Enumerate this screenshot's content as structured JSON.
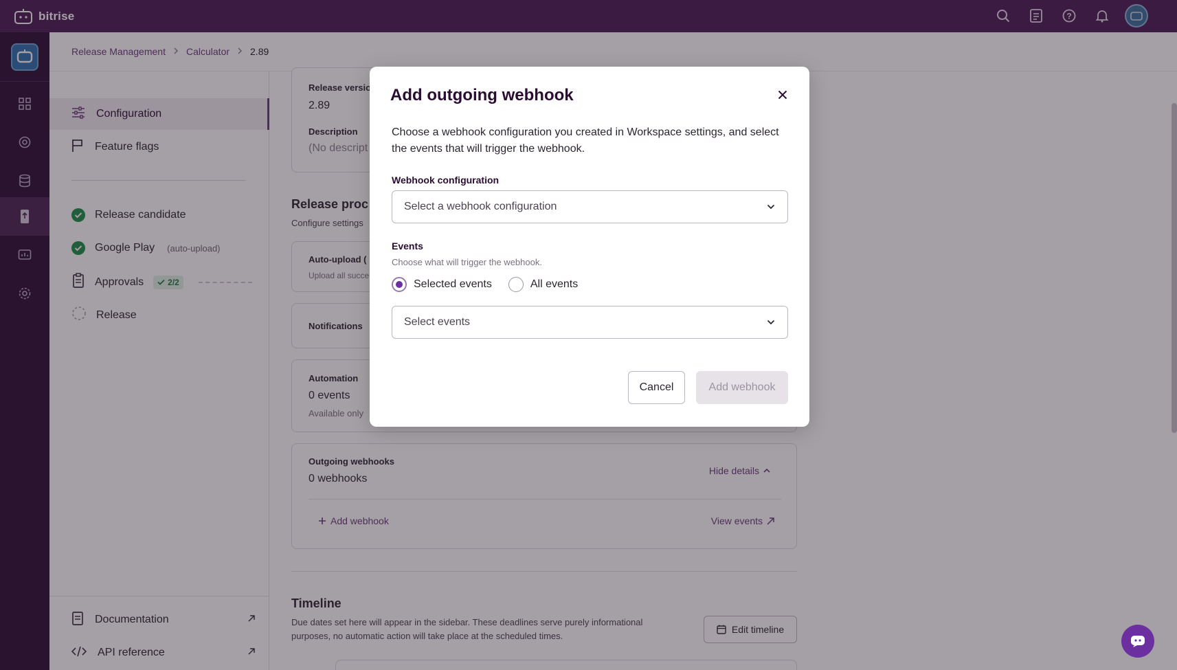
{
  "brand": {
    "name": "bitrise"
  },
  "topbar": {
    "icons": [
      "search-icon",
      "docs-icon",
      "help-icon",
      "bell-icon",
      "avatar"
    ]
  },
  "breadcrumb": {
    "items": [
      "Release Management",
      "Calculator",
      "2.89"
    ]
  },
  "left_nav": {
    "items": [
      {
        "label": "Configuration",
        "icon": "sliders-icon",
        "active": true
      },
      {
        "label": "Feature flags",
        "icon": "flag-icon",
        "active": false
      }
    ],
    "steps": [
      {
        "label": "Release candidate",
        "status": "done"
      },
      {
        "label": "Google Play",
        "note": "(auto-upload)",
        "status": "done"
      },
      {
        "label": "Approvals",
        "badge": "2/2",
        "status": "pending"
      },
      {
        "label": "Release",
        "status": "not-started"
      }
    ],
    "footer": [
      {
        "label": "Documentation",
        "icon": "document-icon"
      },
      {
        "label": "API reference",
        "icon": "code-icon"
      }
    ]
  },
  "main": {
    "release_version_label": "Release versio",
    "release_version_value": "2.89",
    "description_label": "Description",
    "description_value": "(No descript",
    "release_process_title": "Release proc",
    "release_process_sub": "Configure settings",
    "auto_upload_label": "Auto-upload (",
    "auto_upload_sub": "Upload all succe",
    "notifications_label": "Notifications",
    "automation_label": "Automation",
    "automation_value": "0 events",
    "automation_sub": "Available only",
    "webhooks_label": "Outgoing webhooks",
    "webhooks_value": "0 webhooks",
    "hide_details": "Hide details",
    "add_webhook": "Add webhook",
    "view_events": "View events",
    "timeline_title": "Timeline",
    "timeline_text_1": "Due dates set here will appear in the sidebar. These deadlines serve purely informational",
    "timeline_text_2": "purposes, no automatic action will take place at the scheduled times.",
    "edit_timeline": "Edit timeline"
  },
  "dialog": {
    "title": "Add outgoing webhook",
    "intro": "Choose a webhook configuration you created in Workspace settings, and select the events that will trigger the webhook.",
    "webhook_config_label": "Webhook configuration",
    "webhook_config_placeholder": "Select a webhook configuration",
    "events_label": "Events",
    "events_hint": "Choose what will trigger the webhook.",
    "radio_selected": "Selected events",
    "radio_all": "All events",
    "events_selected_option": "selected",
    "events_placeholder": "Select events",
    "cancel_label": "Cancel",
    "add_label": "Add webhook"
  },
  "colors": {
    "topbar": "#4a1a55",
    "rail": "#2b0d33",
    "accent": "#6b2fa0",
    "success": "#1e8f4a"
  }
}
